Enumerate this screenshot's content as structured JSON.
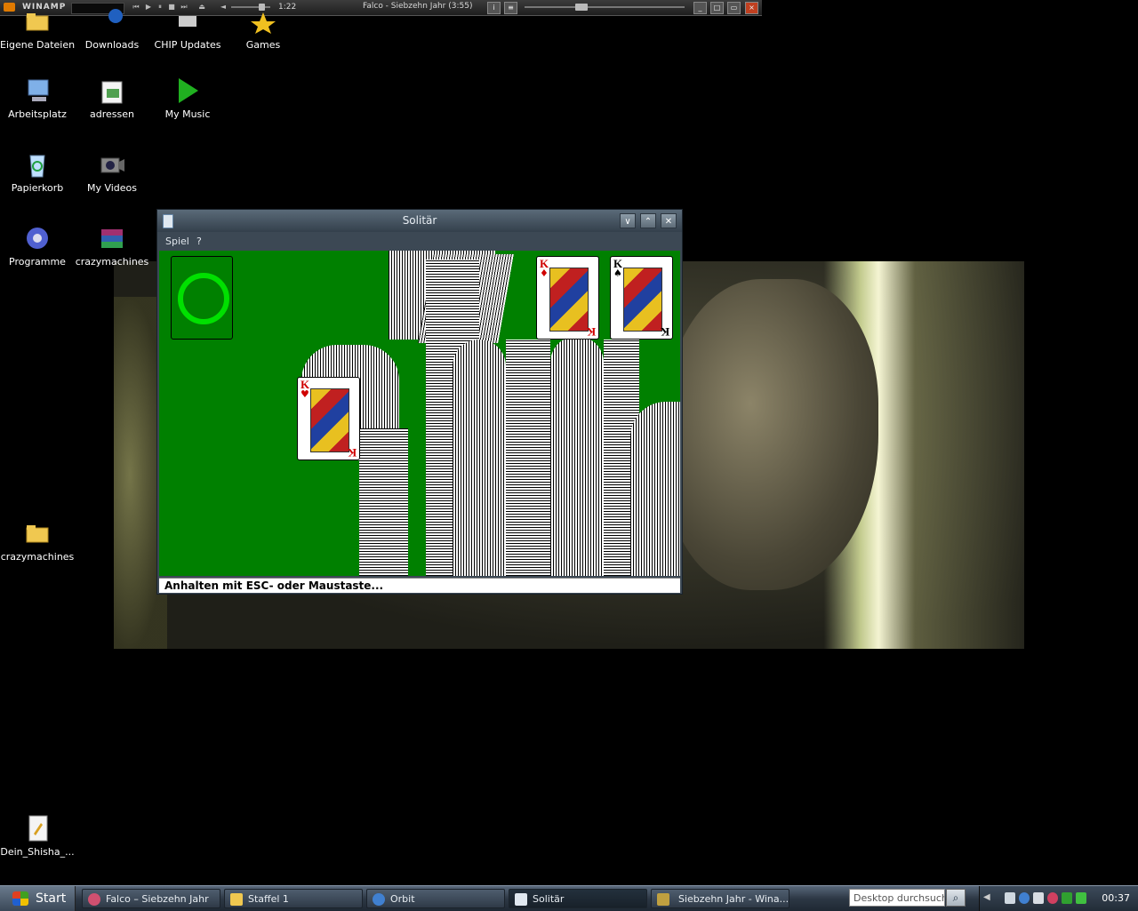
{
  "winamp": {
    "title": "WINAMP",
    "time": "1:22",
    "track": "Falco - Siebzehn Jahr (3:55)"
  },
  "desktop_icons": [
    {
      "label": "Eigene Dateien",
      "icon": "folder-icon"
    },
    {
      "label": "Downloads",
      "icon": "downloads-icon"
    },
    {
      "label": "CHIP Updates",
      "icon": "chip-updates-icon"
    },
    {
      "label": "Games",
      "icon": "star-icon"
    },
    {
      "label": "Arbeitsplatz",
      "icon": "computer-icon"
    },
    {
      "label": "adressen",
      "icon": "spreadsheet-icon"
    },
    {
      "label": "My Music",
      "icon": "play-icon"
    },
    {
      "label": "Papierkorb",
      "icon": "recycle-bin-icon"
    },
    {
      "label": "My Videos",
      "icon": "camera-icon"
    },
    {
      "label": "Programme",
      "icon": "gear-icon"
    },
    {
      "label": "crazymachines",
      "icon": "archive-icon"
    },
    {
      "label": "crazymachines",
      "icon": "folder-icon"
    },
    {
      "label": "Dein_Shisha_...",
      "icon": "document-icon"
    }
  ],
  "solitaire": {
    "title": "Solitär",
    "menu": [
      "Spiel",
      "?"
    ],
    "status": "Anhalten mit ESC- oder Maustaste...",
    "cards": [
      {
        "rank": "K",
        "suit": "♦",
        "color": "red"
      },
      {
        "rank": "K",
        "suit": "♠",
        "color": "black"
      },
      {
        "rank": "K",
        "suit": "♥",
        "color": "red"
      }
    ]
  },
  "taskbar": {
    "start": "Start",
    "items": [
      {
        "label": "Falco – Siebzehn Jahr",
        "icon": "winamp-icon"
      },
      {
        "label": "Staffel 1",
        "icon": "folder-icon"
      },
      {
        "label": "Orbit",
        "icon": "download-icon"
      },
      {
        "label": "Solitär",
        "icon": "cards-icon",
        "active": true
      },
      {
        "label": "Siebzehn Jahr - Wina...",
        "icon": "winrar-icon"
      }
    ],
    "search_placeholder": "Desktop durchsuchen",
    "clock": "00:37"
  },
  "colors": {
    "felt": "#008000",
    "desktop": "#000000",
    "taskbar": "#2d3845"
  }
}
